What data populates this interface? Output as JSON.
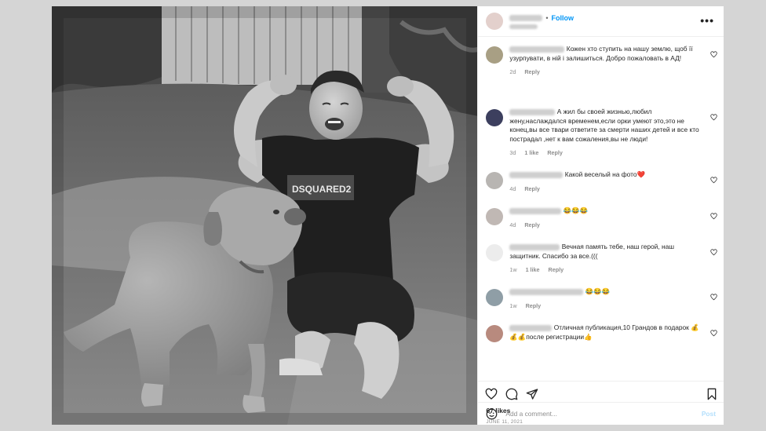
{
  "header": {
    "follow_label": "Follow",
    "separator": "•",
    "more_label": "•••"
  },
  "comments": [
    {
      "text": "Кожен хто ступить на нашу землю, щоб її узурпувати, в ній і залишиться. Добро пожаловать в АД!",
      "time": "2d",
      "likes": "",
      "reply": "Reply",
      "avatar_color": "#a89f84"
    },
    {
      "text": "А жил бы своей жизнью,любил жену,наслаждался временем,если орки умеют это,это не конец,вы все твари ответите за смерти наших детей и все кто пострадал ,нет к вам сожаления,вы не люди!",
      "time": "3d",
      "likes": "1 like",
      "reply": "Reply",
      "avatar_color": "#3c3f5e"
    },
    {
      "text": "Какой веселый на фото❤️",
      "time": "4d",
      "likes": "",
      "reply": "Reply",
      "avatar_color": "#b8b5b2"
    },
    {
      "text": "😂😂😂",
      "time": "4d",
      "likes": "",
      "reply": "Reply",
      "avatar_color": "#c0b8b4"
    },
    {
      "text": "Вечная память тебе, наш герой, наш защитник. Спасибо за все.(((",
      "time": "1w",
      "likes": "1 like",
      "reply": "Reply",
      "avatar_color": "#ececec"
    },
    {
      "text": "😂😂😂",
      "time": "1w",
      "likes": "",
      "reply": "Reply",
      "avatar_color": "#8f9ea6"
    },
    {
      "text": "Отличная публикация,10 Грандов в подарок 💰💰💰после регистрации👍",
      "time": "",
      "likes": "",
      "reply": "",
      "avatar_color": "#b88a7e"
    }
  ],
  "post": {
    "likes": "67 likes",
    "date": "JUNE 11, 2021"
  },
  "add_comment": {
    "placeholder": "Add a comment...",
    "post_label": "Post"
  },
  "photo": {
    "shirt_text": "DSQUARED2"
  }
}
